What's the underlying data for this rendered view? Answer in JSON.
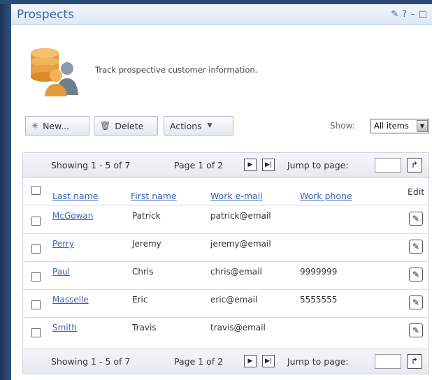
{
  "window": {
    "title": "Prospects",
    "controls": [
      "edit",
      "help",
      "minimize",
      "close"
    ]
  },
  "header": {
    "description": "Track prospective customer information."
  },
  "toolbar": {
    "new_label": "New...",
    "delete_label": "Delete",
    "actions_label": "Actions",
    "show_label": "Show:",
    "show_value": "All items"
  },
  "pager": {
    "showing": "Showing 1 - 5 of 7",
    "page_of": "Page 1 of 2",
    "jump_label": "Jump to page:"
  },
  "table": {
    "columns": {
      "last_name": "Last name",
      "first_name": "First name",
      "work_email": "Work e-mail",
      "work_phone": "Work phone",
      "edit": "Edit"
    },
    "rows": [
      {
        "last": "McGowan",
        "first": "Patrick",
        "email": "patrick@email",
        "phone": ""
      },
      {
        "last": "Perry",
        "first": "Jeremy",
        "email": "jeremy@email",
        "phone": ""
      },
      {
        "last": "Paul",
        "first": "Chris",
        "email": "chris@email",
        "phone": "9999999"
      },
      {
        "last": "Masselle",
        "first": "Eric",
        "email": "eric@email",
        "phone": "5555555"
      },
      {
        "last": "Smith",
        "first": "Travis",
        "email": "travis@email",
        "phone": ""
      }
    ]
  },
  "colors": {
    "accent": "#3a68a8",
    "link": "#3a63b8",
    "frame": "#2a4a72"
  }
}
